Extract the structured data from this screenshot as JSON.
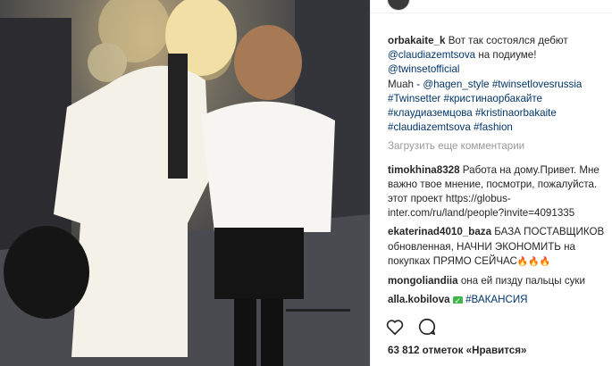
{
  "post": {
    "author": "orbakaite_k",
    "caption_lines": [
      "Вот так состоялся дебют",
      "@claudiazemtsova",
      "на подиуме!",
      "@twinsetofficial",
      "Muah - ",
      "@hagen_style",
      "#twinsetlovesrussia",
      "#Twinsetter",
      "#кристинаорбакайте",
      "#клаудиаземцова",
      "#kristinaorbakaite",
      "#claudiazemtsova",
      "#fashion"
    ],
    "load_more": "Загрузить еще комментарии",
    "likes": "63 812 отметок «Нравится»"
  },
  "comments": [
    {
      "user": "timokhina8328",
      "text": "Работа на дому.Привет. Мне важно твое мнение, посмотри, пожалуйста. этот проект https://globus-inter.com/ru/land/people?invite=4091335"
    },
    {
      "user": "ekaterinad4010_baza",
      "text": "БАЗА ПОСТАВЩИКОВ обновленная, НАЧНИ ЭКОНОМИТЬ на покупках ПРЯМО СЕЙЧАС",
      "emoji": "🔥🔥🔥"
    },
    {
      "user": "mongoliandiia",
      "text": "она ей пизду пальцы суки"
    },
    {
      "user": "alla.kobilova",
      "emoji_badge": "✓",
      "text": "#ВАКАНСИЯ"
    }
  ],
  "icons": {
    "like": "heart-outline-icon",
    "comment": "comment-bubble-icon"
  },
  "colors": {
    "link": "#003569",
    "text": "#262626",
    "muted": "#999999"
  }
}
